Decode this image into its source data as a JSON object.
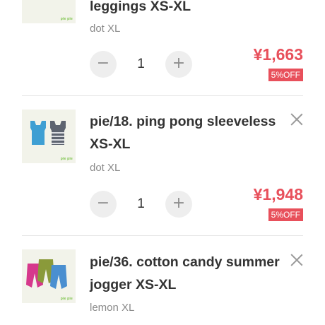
{
  "cart": {
    "items": [
      {
        "title_lines": [
          "leggings XS-XL"
        ],
        "variant": "dot XL",
        "quantity": "1",
        "price": "¥1,663",
        "discount": "5%OFF",
        "thumb_brand": "pie pie",
        "thumb_icon": "leggings-product-image"
      },
      {
        "title_lines": [
          "pie/18. ping pong sleeveless",
          "XS-XL"
        ],
        "variant": "dot XL",
        "quantity": "1",
        "price": "¥1,948",
        "discount": "5%OFF",
        "thumb_brand": "pie pie",
        "thumb_icon": "sleeveless-product-image"
      },
      {
        "title_lines": [
          "pie/36. cotton candy summer",
          "jogger XS-XL"
        ],
        "variant": "lemon XL",
        "thumb_brand": "pie pie",
        "thumb_icon": "jogger-product-image"
      }
    ],
    "controls": {
      "minus_glyph": "−",
      "plus_glyph": "+"
    },
    "colors": {
      "price": "#e8505b",
      "discount_badge": "#e8505b",
      "qty_button": "#eeeeee"
    }
  }
}
